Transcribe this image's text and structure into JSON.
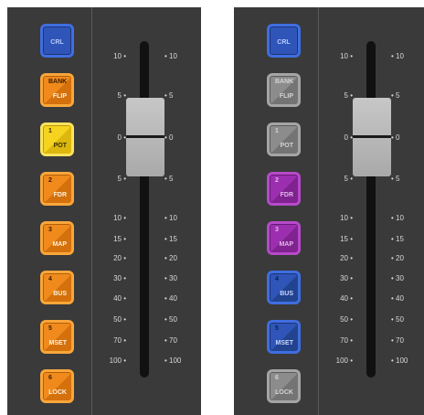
{
  "panels": [
    {
      "buttons": [
        {
          "style": "blue",
          "center": "CRL"
        },
        {
          "style": "orange",
          "top": "BANK",
          "bottom": "FLIP"
        },
        {
          "style": "yellow",
          "top": "1",
          "bottom": "POT"
        },
        {
          "style": "orange",
          "top": "2",
          "bottom": "FDR"
        },
        {
          "style": "orange",
          "top": "3",
          "bottom": "MAP"
        },
        {
          "style": "orange",
          "top": "4",
          "bottom": "BUS"
        },
        {
          "style": "orange",
          "top": "5",
          "bottom": "MSET"
        },
        {
          "style": "orange",
          "top": "6",
          "bottom": "LOCK"
        }
      ],
      "fader_level": 0
    },
    {
      "buttons": [
        {
          "style": "blue",
          "center": "CRL"
        },
        {
          "style": "gray",
          "top": "BANK",
          "bottom": "FLIP"
        },
        {
          "style": "gray",
          "top": "1",
          "bottom": "POT"
        },
        {
          "style": "purple",
          "top": "2",
          "bottom": "FDR"
        },
        {
          "style": "purple",
          "top": "3",
          "bottom": "MAP"
        },
        {
          "style": "blue",
          "top": "4",
          "bottom": "BUS"
        },
        {
          "style": "blue",
          "top": "5",
          "bottom": "MSET"
        },
        {
          "style": "gray",
          "top": "6",
          "bottom": "LOCK"
        }
      ],
      "fader_level": 0
    }
  ],
  "scale": {
    "left": [
      "10 •",
      "5 •",
      "0 •",
      "5 •",
      "10 •",
      "15 •",
      "20 •",
      "30 •",
      "40 •",
      "50 •",
      "70 •",
      "100 •"
    ],
    "right": [
      "• 10",
      "• 5",
      "• 0",
      "• 5",
      "• 10",
      "• 15",
      "• 20",
      "• 30",
      "• 40",
      "• 50",
      "• 70",
      "• 100"
    ]
  },
  "colors": {
    "panel_bg": "#3a3a3a",
    "blue": "#2f55b8",
    "orange": "#f08a1c",
    "yellow": "#f6d31f",
    "gray": "#8c8c8c",
    "purple": "#9c2fb0",
    "fader_cap": "#b8b8b8",
    "fader_track": "#111111"
  }
}
